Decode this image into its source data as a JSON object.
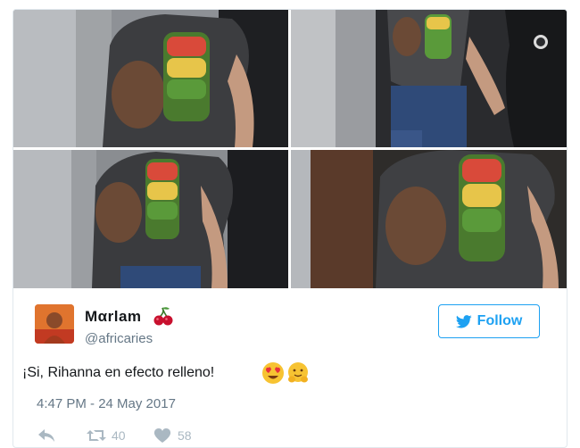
{
  "tweet": {
    "user": {
      "name": "Mαrlam",
      "handle": "@africaries"
    },
    "follow_label": "Follow",
    "text": "¡Si, Rihanna en efecto relleno!",
    "timestamp": "4:47 PM - 24 May 2017",
    "retweets": "40",
    "likes": "58",
    "icons": {
      "badge": "cherry-icon",
      "follow": "twitter-bird-icon",
      "emoji_1": "heart-eyes-emoji-icon",
      "emoji_2": "hugging-emoji-icon",
      "reply": "reply-icon",
      "retweet": "retweet-icon",
      "like": "heart-icon"
    },
    "colors": {
      "accent": "#1da1f2",
      "text": "#14171a",
      "muted": "#657786",
      "border": "#e1e8ed"
    }
  }
}
